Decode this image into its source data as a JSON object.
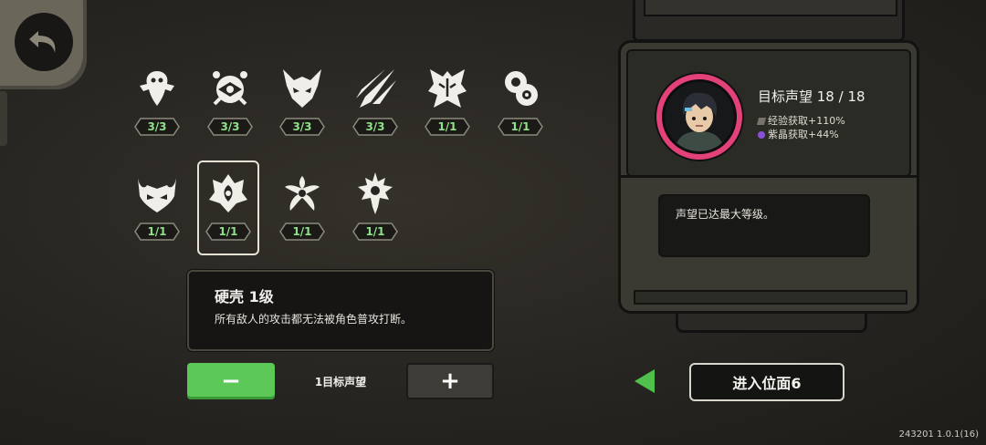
{
  "back_button": {
    "icon": "undo-arrow-icon"
  },
  "traits": [
    {
      "name": "turtle-sigil-icon",
      "count": "3/3"
    },
    {
      "name": "eye-orb-sigil-icon",
      "count": "3/3"
    },
    {
      "name": "horned-mask-sigil-icon",
      "count": "3/3"
    },
    {
      "name": "claw-slash-sigil-icon",
      "count": "3/3"
    },
    {
      "name": "mirror-mask-sigil-icon",
      "count": "1/1"
    },
    {
      "name": "swirl-sigil-icon",
      "count": "1/1"
    },
    {
      "name": "demon-face-sigil-icon",
      "count": "1/1"
    },
    {
      "name": "shell-crest-sigil-icon",
      "count": "1/1"
    },
    {
      "name": "spiral-star-sigil-icon",
      "count": "1/1"
    },
    {
      "name": "spiked-orb-sigil-icon",
      "count": "1/1"
    }
  ],
  "selected_index": 7,
  "info": {
    "title": "硬壳 1级",
    "description": "所有敌人的攻击都无法被角色普攻打断。"
  },
  "controls": {
    "minus_label": "−",
    "plus_label": "+",
    "level_label": "1目标声望"
  },
  "reputation": {
    "title": "目标声望 18 / 18",
    "exp_bonus": "经验获取+110%",
    "crystal_bonus": "紫晶获取+44%",
    "message": "声望已达最大等级。"
  },
  "enter_button": "进入位面6",
  "version": "243201 1.0.1(16)",
  "colors": {
    "accent_green": "#5cc858",
    "count_green": "#8fe08a",
    "avatar_ring": "#e2417a",
    "crystal_purple": "#8a4fd8"
  }
}
